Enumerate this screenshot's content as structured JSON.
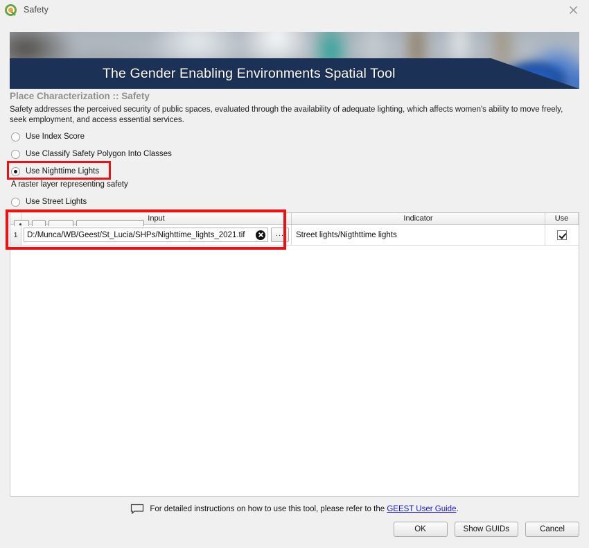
{
  "window": {
    "title": "Safety",
    "app_icon": "qgis-logo-icon",
    "close_icon": "close-icon"
  },
  "banner": {
    "title": "The Gender Enabling Environments Spatial Tool",
    "band_color": "#1c3156"
  },
  "section": {
    "title": "Place Characterization :: Safety",
    "description": "Safety addresses the perceived security of public spaces, evaluated through the availability of adequate lighting, which affects women's ability to move freely, seek employment, and access essential services."
  },
  "options": {
    "index_score": "Use Index Score",
    "classify_polygon": "Use Classify Safety Polygon Into Classes",
    "nighttime_lights": "Use Nighttime Lights",
    "street_lights": "Use Street Lights",
    "selected": "nighttime_lights",
    "hint": "A raster layer representing safety",
    "highlight_color": "#ee1111"
  },
  "table": {
    "headers": {
      "rownum": "",
      "input": "Input",
      "indicator": "Indicator",
      "use": "Use"
    },
    "rows": [
      {
        "rownum": "1",
        "input_value": "D:/Munca/WB/Geest/St_Lucia/SHPs/Nighttime_lights_2021.tif",
        "input_placeholder": "",
        "browse_label": "...",
        "clear_icon": "clear-x-icon",
        "indicator": "Street lights/Nigthttime lights",
        "use_checked": true
      }
    ]
  },
  "footer": {
    "help_icon": "speech-bubble-icon",
    "help_text_before": "For detailed instructions on how to use this tool, please refer to the ",
    "help_link": "GEEST User Guide",
    "help_text_after": ".",
    "buttons": {
      "ok": "OK",
      "show_guids": "Show GUIDs",
      "cancel": "Cancel"
    }
  }
}
